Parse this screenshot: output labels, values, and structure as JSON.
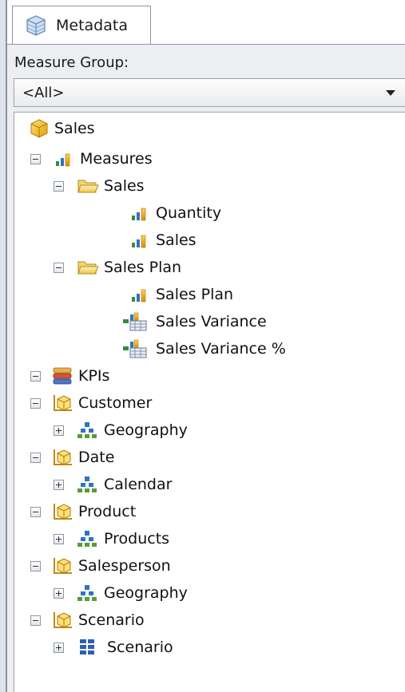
{
  "tab": {
    "label": "Metadata",
    "icon": "cube-database-icon"
  },
  "measure_group": {
    "label": "Measure Group:",
    "selected": "<All>"
  },
  "tree": {
    "root": "Sales",
    "measures": {
      "label": "Measures",
      "folder_sales": {
        "label": "Sales",
        "items": [
          "Quantity",
          "Sales"
        ]
      },
      "folder_sales_plan": {
        "label": "Sales Plan",
        "items": [
          "Sales Plan",
          "Sales Variance",
          "Sales Variance %"
        ]
      }
    },
    "kpis": "KPIs",
    "dimensions": [
      {
        "label": "Customer",
        "hierarchy": "Geography"
      },
      {
        "label": "Date",
        "hierarchy": "Calendar"
      },
      {
        "label": "Product",
        "hierarchy": "Products"
      },
      {
        "label": "Salesperson",
        "hierarchy": "Geography"
      },
      {
        "label": "Scenario",
        "hierarchy": "Scenario"
      }
    ]
  }
}
